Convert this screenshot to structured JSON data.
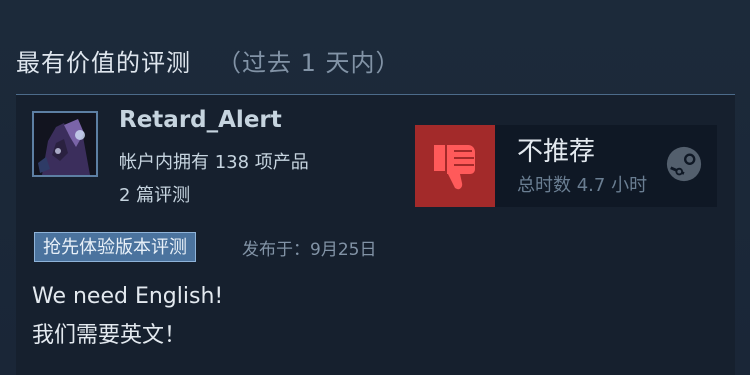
{
  "section": {
    "title": "最有价值的评测",
    "range": "（过去 1 天内）"
  },
  "review": {
    "username": "Retard_Alert",
    "products_owned": "帐户内拥有 138 项产品",
    "review_count": "2 篇评测",
    "vote": {
      "label": "不推荐",
      "hours": "总时数 4.7 小时",
      "icon": "thumbs-down-icon",
      "color": "#a32a2a"
    },
    "badge": "抢先体验版本评测",
    "posted": "发布于：9月25日",
    "body_lines": [
      "We need English!",
      "我们需要英文！"
    ]
  }
}
